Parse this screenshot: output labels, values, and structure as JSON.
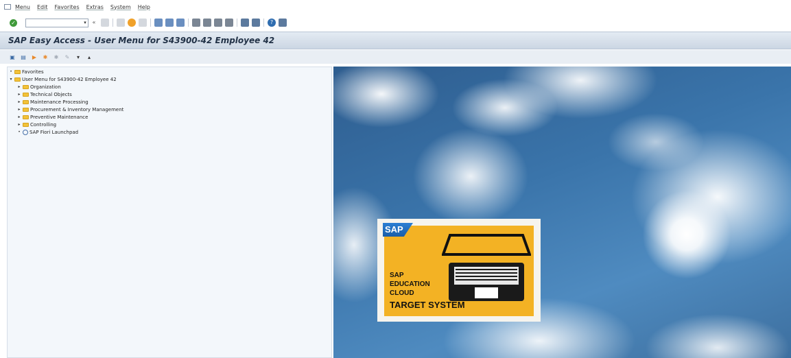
{
  "menubar": {
    "items": [
      "Menu",
      "Edit",
      "Favorites",
      "Extras",
      "System",
      "Help"
    ]
  },
  "toolbar": {
    "command_field_value": "",
    "icons": [
      "enter-icon",
      "save-icon",
      "back-icon",
      "exit-icon",
      "cancel-icon",
      "print-icon",
      "find-icon",
      "find-next-icon",
      "first-page-icon",
      "previous-page-icon",
      "next-page-icon",
      "last-page-icon",
      "create-session-icon",
      "shortcut-icon",
      "help-icon",
      "layout-menu-icon"
    ]
  },
  "title": "SAP Easy Access  -  User Menu for S43900-42 Employee 42",
  "app_toolbar": {
    "icons": [
      "other-menu-icon",
      "sap-menu-icon",
      "user-menu-icon",
      "add-favorite-icon",
      "delete-favorite-icon",
      "change-favorite-icon",
      "expand-icon",
      "collapse-icon"
    ]
  },
  "tree": {
    "favorites": "Favorites",
    "user_menu": "User Menu for S43900-42 Employee 42",
    "children": [
      "Organization",
      "Technical Objects",
      "Maintenance Processing",
      "Procurement & Inventory Management",
      "Preventive Maintenance",
      "Controlling",
      "SAP Fiori Launchpad"
    ]
  },
  "logo": {
    "sap": "SAP",
    "education": "SAP\nEDUCATION\nCLOUD",
    "target": "TARGET SYSTEM"
  },
  "colors": {
    "title_bar": "#cbd6e3",
    "tree_bg": "#f3f7fb",
    "folder": "#f2c23a",
    "logo_yellow": "#f3b224",
    "sap_blue": "#1a5ea8"
  }
}
